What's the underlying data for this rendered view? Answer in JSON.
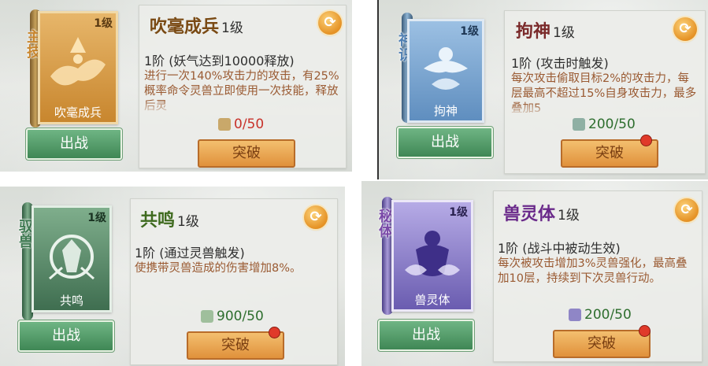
{
  "colors": {
    "gold": "#c8862e",
    "blue": "#5f8ebf",
    "green": "#4a7d5b",
    "purple": "#6a5cb0",
    "desc": "#9a5a32",
    "count_red": "#c8322a",
    "count_green": "#2e6e2e"
  },
  "cards": [
    {
      "scroll_name": "吹毫成兵",
      "scroll_level": "1级",
      "ribbon": "主技",
      "title": "吹毫成兵",
      "title_level": "1级",
      "stage": "1阶 (妖气达到10000释放)",
      "desc": "进行一次140%攻击力的攻击，有25%概率命令灵兽立即使用一次技能，释放后灵",
      "count": "0/50",
      "deploy_label": "出战",
      "breakthrough_label": "突破",
      "refresh_icon": "refresh-icon",
      "has_red_dot": false
    },
    {
      "scroll_name": "拘神",
      "scroll_level": "1级",
      "ribbon": "神识",
      "title": "拘神",
      "title_level": "1级",
      "stage": "1阶 (攻击时触发)",
      "desc": "每次攻击偷取目标2%的攻击力，每层最高不超过15%自身攻击力，最多叠加5",
      "count": "200/50",
      "deploy_label": "出战",
      "breakthrough_label": "突破",
      "refresh_icon": "refresh-icon",
      "has_red_dot": true
    },
    {
      "scroll_name": "共鸣",
      "scroll_level": "1级",
      "ribbon": "驭兽",
      "title": "共鸣",
      "title_level": "1级",
      "stage": "1阶 (通过灵兽触发)",
      "desc": "使携带灵兽造成的伤害增加8%。",
      "count": "900/50",
      "deploy_label": "出战",
      "breakthrough_label": "突破",
      "refresh_icon": "refresh-icon",
      "has_red_dot": true
    },
    {
      "scroll_name": "兽灵体",
      "scroll_level": "1级",
      "ribbon": "秘体",
      "title": "兽灵体",
      "title_level": "1级",
      "stage": "1阶 (战斗中被动生效)",
      "desc": "每次被攻击增加3%灵兽强化，最高叠加10层，持续到下次灵兽行动。",
      "count": "200/50",
      "deploy_label": "出战",
      "breakthrough_label": "突破",
      "refresh_icon": "refresh-icon",
      "has_red_dot": true
    }
  ]
}
